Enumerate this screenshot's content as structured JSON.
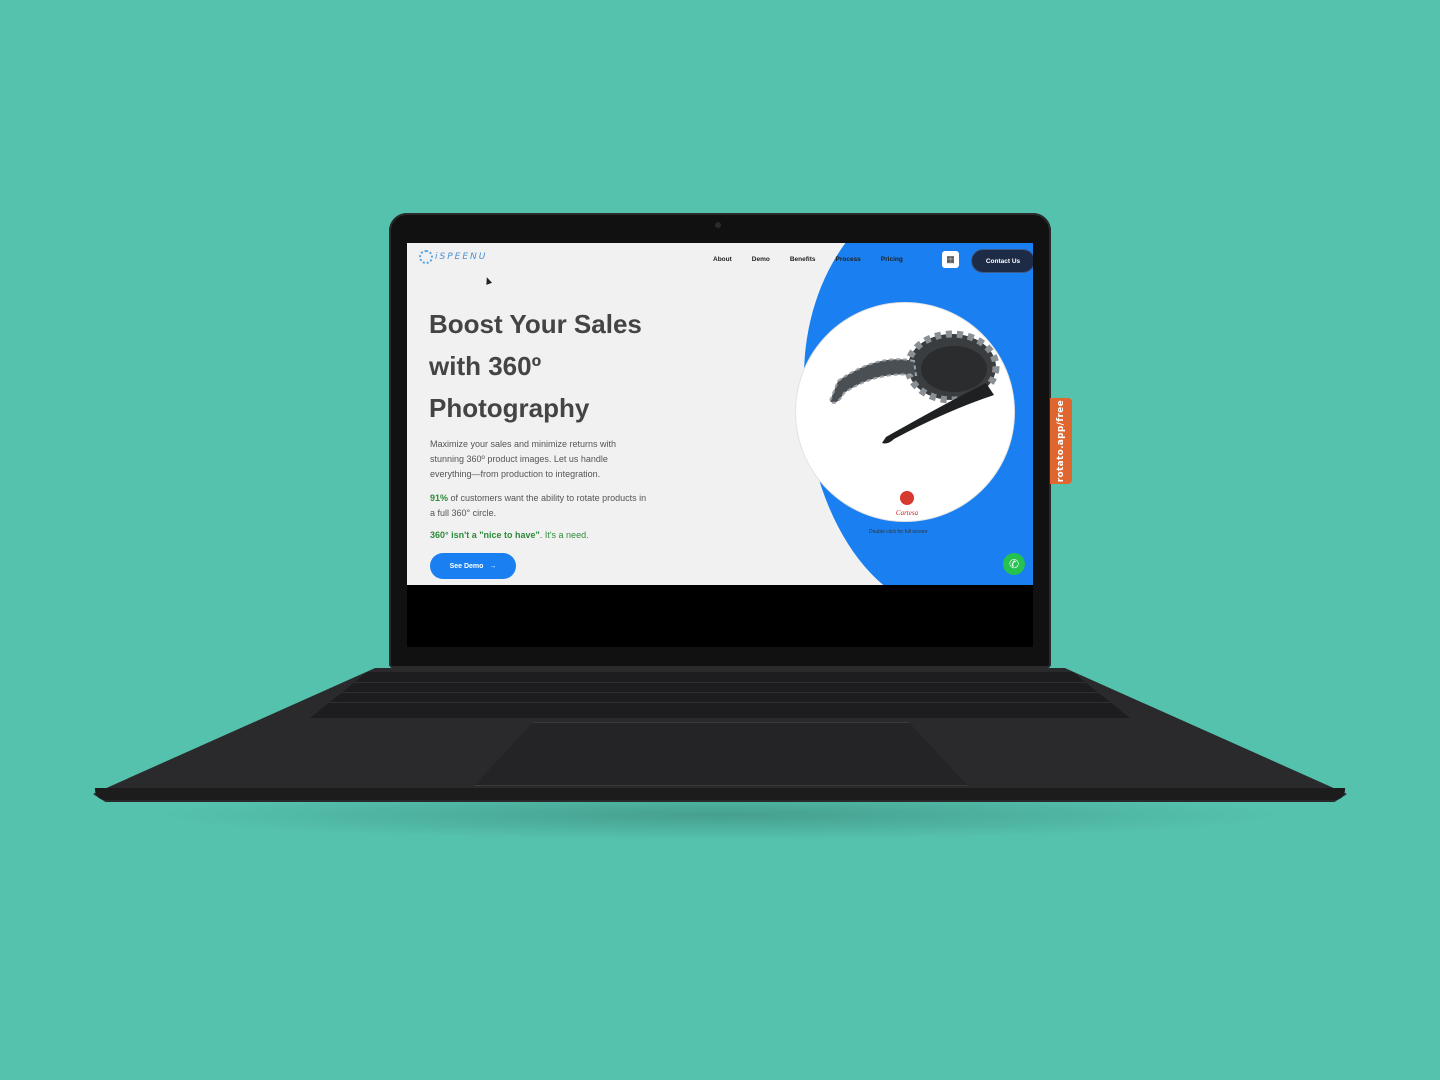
{
  "side_tab": {
    "label": "rotato.app/free"
  },
  "site": {
    "logo_text": "iSPEENU",
    "nav": [
      "About",
      "Demo",
      "Benefits",
      "Process",
      "Pricing"
    ],
    "contact_label": "Contact Us",
    "hero": {
      "title": "Boost Your Sales\nwith 360º\nPhotography",
      "text": "Maximize your sales and minimize returns with stunning 360º product images. Let us handle everything—from production to integration.",
      "stat_pct": "91%",
      "stat_text": " of customers want the ability to rotate products in a full 360° circle.",
      "need_bold": "360° isn't a \"nice to have\"",
      "need_rest": ". It's a need.",
      "demo_label": "See Demo",
      "demo_arrow": "→"
    },
    "product": {
      "brand": "Cartesa",
      "hint": "Double click for full screen"
    },
    "colors": {
      "accent": "#1a7ff0",
      "green": "#2e8b3a",
      "contact_bg": "#1d2b47",
      "background": "#55c2ae"
    }
  }
}
